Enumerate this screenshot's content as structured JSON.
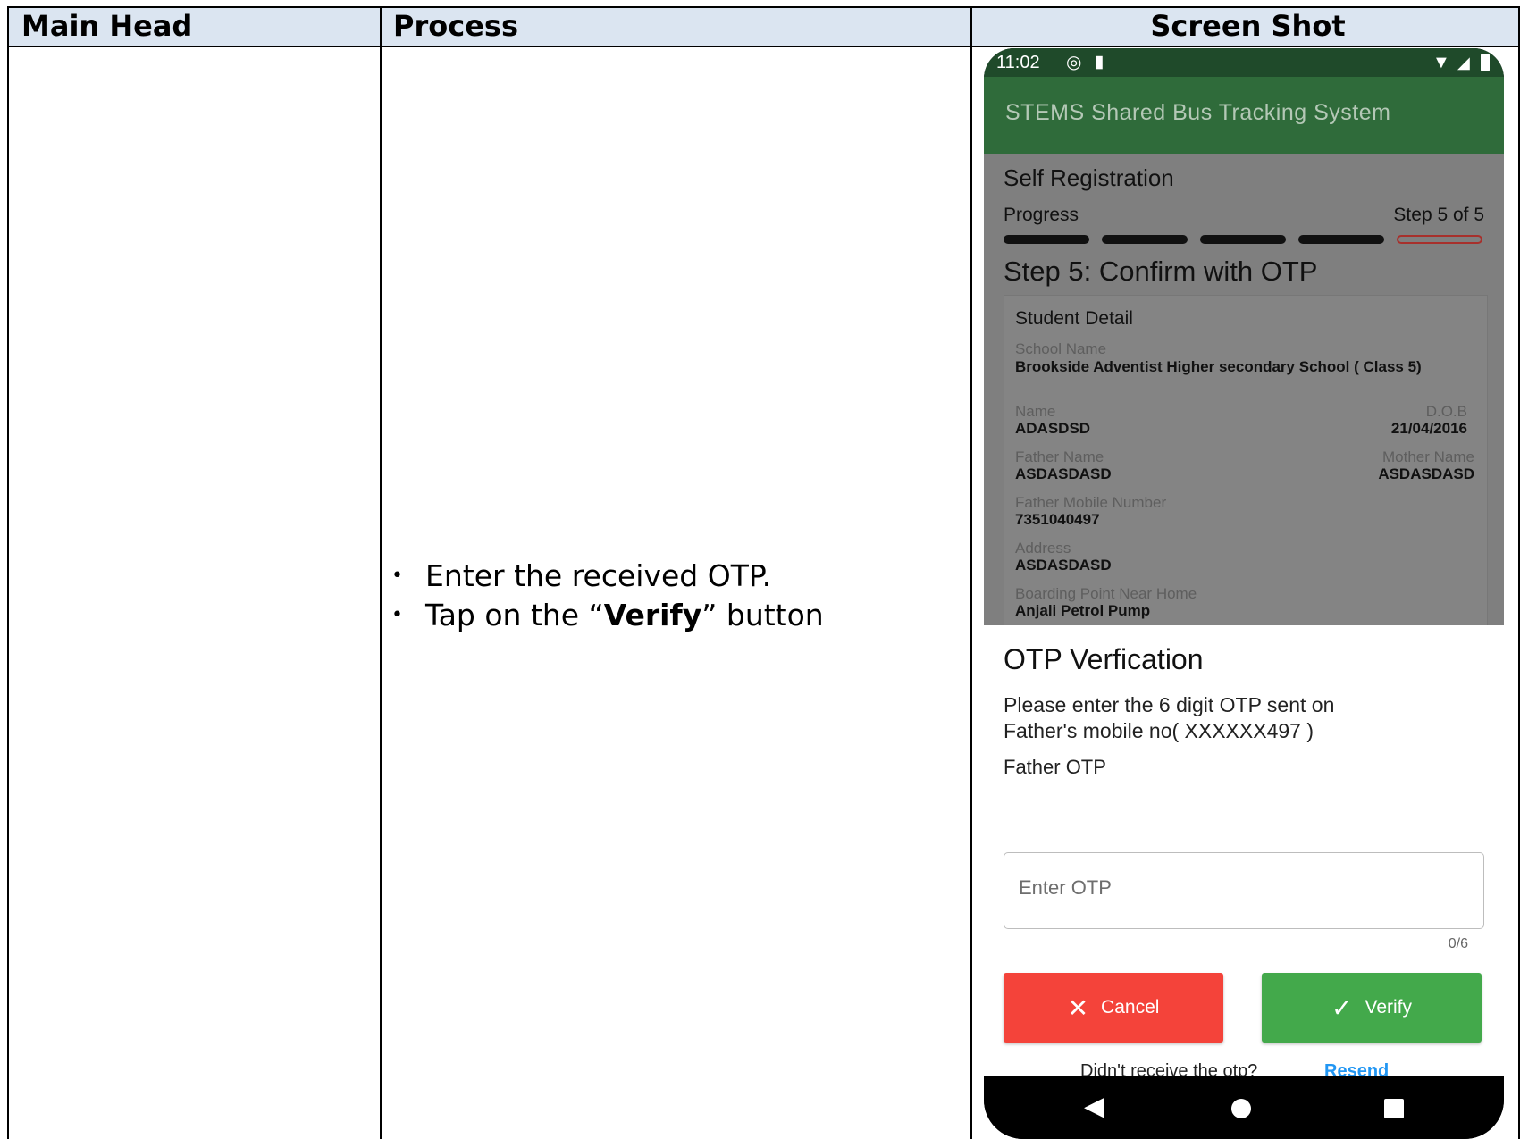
{
  "table": {
    "headers": [
      "Main Head",
      "Process",
      "Screen Shot"
    ],
    "process_steps": [
      {
        "prefix": "Enter the received OTP.",
        "bold": "",
        "suffix": ""
      },
      {
        "prefix": "Tap on the “",
        "bold": "Verify",
        "suffix": "” button"
      }
    ]
  },
  "phone": {
    "status_time": "11:02",
    "app_title": "STEMS Shared Bus Tracking System",
    "page_title": "Self Registration",
    "progress_label": "Progress",
    "step_count": "Step 5 of 5",
    "step_title": "Step 5: Confirm with OTP",
    "card_title": "Student Detail",
    "school_label": "School Name",
    "school_value": "Brookside Adventist Higher secondary School ( Class 5)",
    "name_label": "Name",
    "name_value": "ADASDSD",
    "dob_label": "D.O.B",
    "dob_value": "21/04/2016",
    "father_label": "Father Name",
    "father_value": "ASDASDASD",
    "mother_label": "Mother Name",
    "mother_value": "ASDASDASD",
    "mobile_label": "Father Mobile Number",
    "mobile_value": "7351040497",
    "address_label": "Address",
    "address_value": "ASDASDASD",
    "boarding_label": "Boarding Point Near Home",
    "boarding_value": "Anjali Petrol Pump",
    "otp_title": "OTP Verfication",
    "otp_message_line1": "Please enter the 6 digit OTP sent on",
    "otp_message_line2": "Father's mobile no( XXXXXX497 )",
    "otp_field_label": "Father OTP",
    "otp_placeholder": "Enter OTP",
    "otp_counter": "0/6",
    "cancel_label": "Cancel",
    "verify_label": "Verify",
    "resend_prompt": "Didn't receive the otp?",
    "resend_label": "Resend",
    "colors": {
      "cancel": "#f4433a",
      "verify": "#43a94b",
      "link": "#2196f3",
      "appbar": "#2f6b3a"
    }
  }
}
